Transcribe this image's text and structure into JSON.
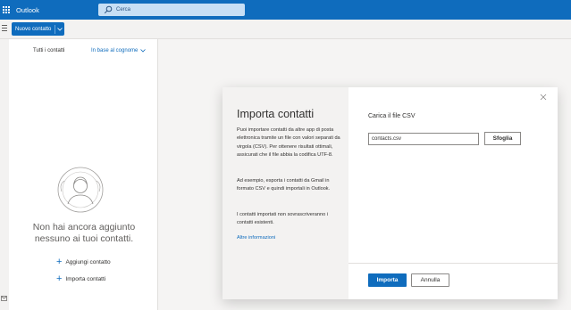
{
  "app": {
    "title": "Outlook"
  },
  "search": {
    "placeholder": "Cerca"
  },
  "toolbar": {
    "new_contact_label": "Nuovo contatto"
  },
  "contacts_panel": {
    "tabs": [
      {
        "label": "Tutti i contatti"
      },
      {
        "label": "In base al cognome"
      }
    ],
    "empty_message": "Non hai ancora aggiunto nessuno ai tuoi contatti.",
    "actions": [
      {
        "label": "Aggiungi contatto",
        "icon": "plus-icon"
      },
      {
        "label": "Importa contatti",
        "icon": "plus-icon"
      }
    ]
  },
  "dialog": {
    "title": "Importa contatti",
    "paragraphs": [
      "Puoi importare contatti da altre app di posta elettronica tramite un file con valori separati da virgola (CSV). Per ottenere risultati ottimali, assicurati che il file abbia la codifica UTF-8.",
      "Ad esempio, esporta i contatti da Gmail in formato CSV e quindi importali in Outlook.",
      "I contatti importati non sovrascriveranno i contatti esistenti."
    ],
    "more_info_link": "Altre informazioni",
    "upload_label": "Carica il file CSV",
    "file_name": "contacts.csv",
    "browse_label": "Sfoglia",
    "import_label": "Importa",
    "cancel_label": "Annulla"
  },
  "colors": {
    "accent": "#0f6cbd",
    "topbar": "#0f6cbd",
    "search_bg": "#c7dff5",
    "panel_bg": "#f3f2f1"
  }
}
